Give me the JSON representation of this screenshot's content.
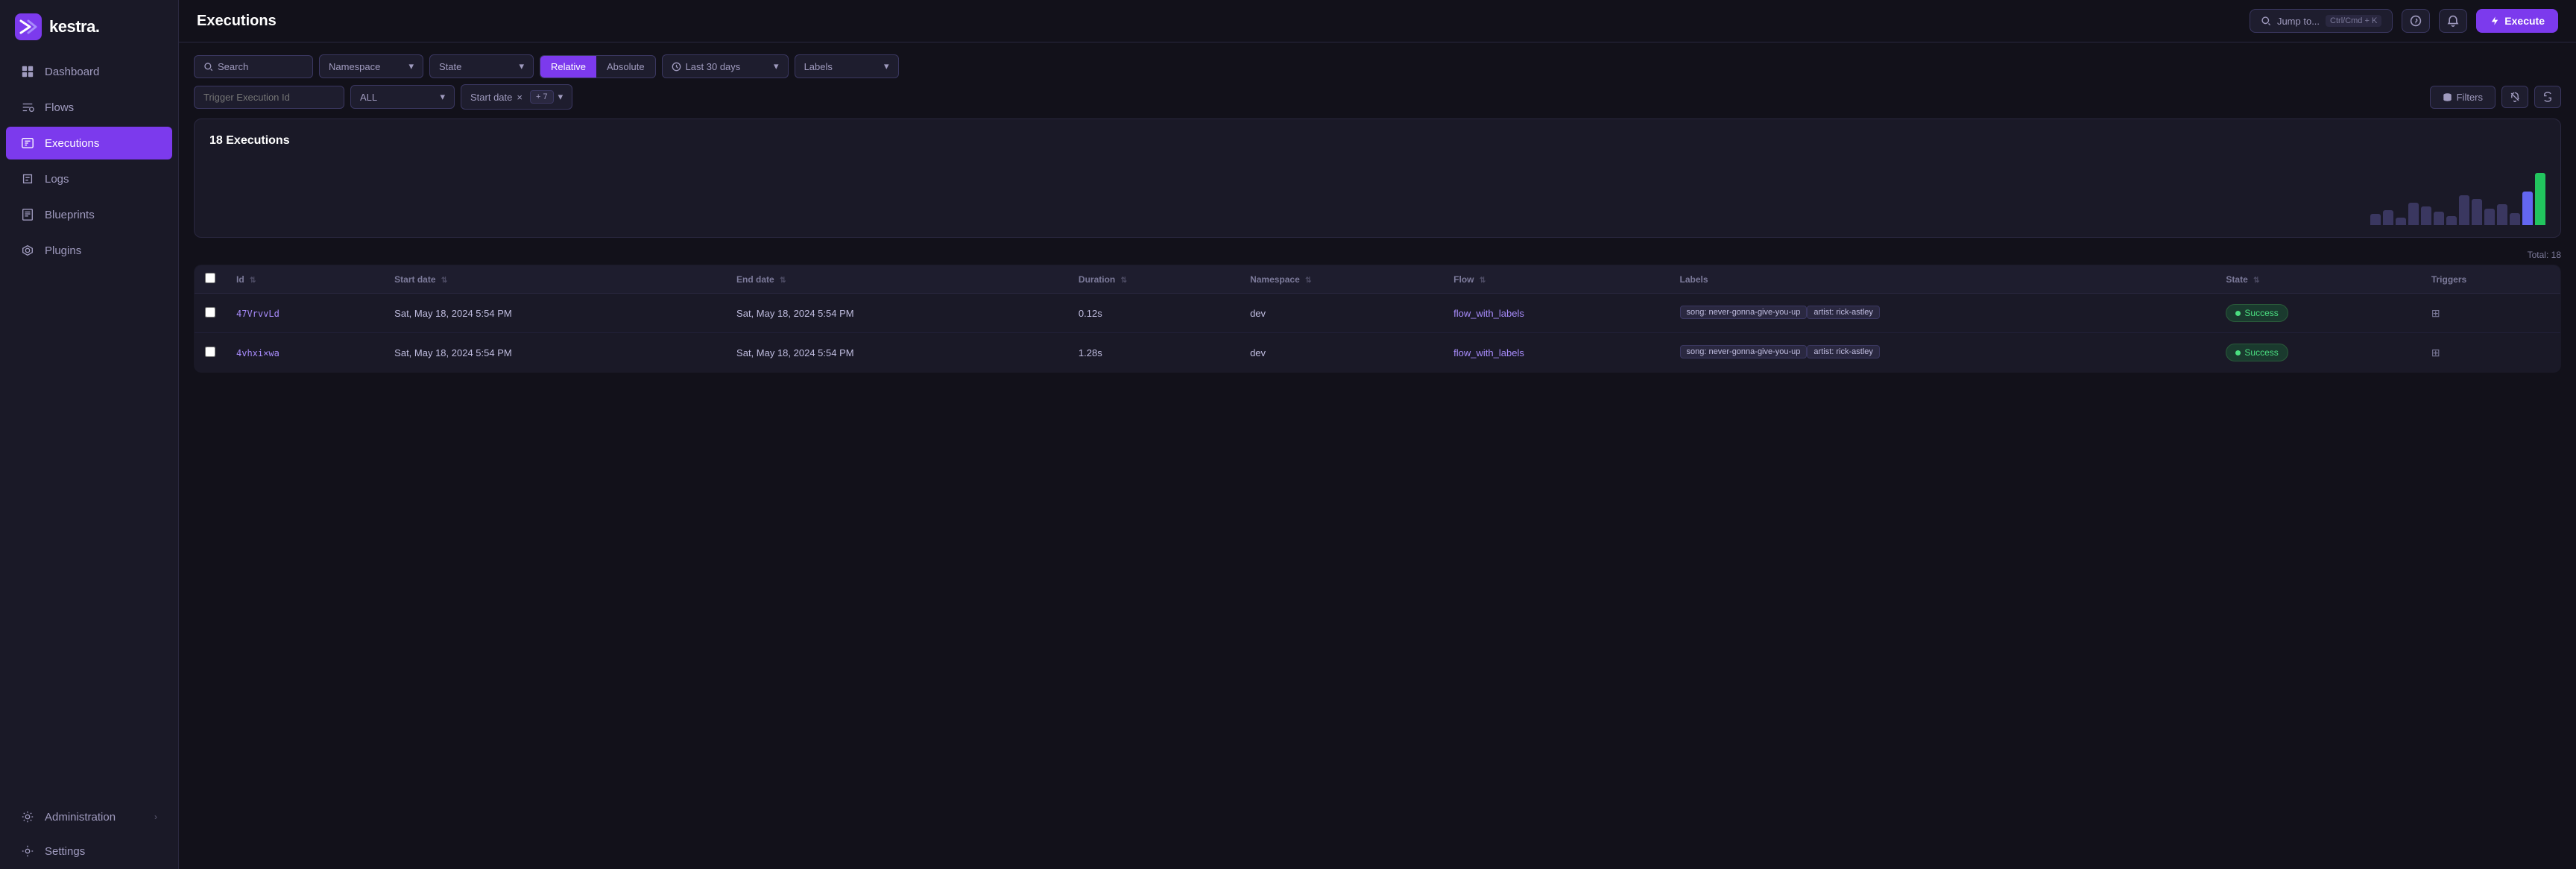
{
  "sidebar": {
    "logo_text": "kestra.",
    "items": [
      {
        "id": "dashboard",
        "label": "Dashboard",
        "icon": "dashboard"
      },
      {
        "id": "flows",
        "label": "Flows",
        "icon": "flows"
      },
      {
        "id": "executions",
        "label": "Executions",
        "icon": "executions",
        "active": true
      },
      {
        "id": "logs",
        "label": "Logs",
        "icon": "logs"
      },
      {
        "id": "blueprints",
        "label": "Blueprints",
        "icon": "blueprints"
      },
      {
        "id": "plugins",
        "label": "Plugins",
        "icon": "plugins"
      },
      {
        "id": "administration",
        "label": "Administration",
        "icon": "administration",
        "has_arrow": true
      },
      {
        "id": "settings",
        "label": "Settings",
        "icon": "settings"
      }
    ]
  },
  "topbar": {
    "page_title": "Executions",
    "jump_to_label": "Jump to...",
    "shortcut": "Ctrl/Cmd + K",
    "execute_label": "Execute"
  },
  "filters": {
    "search_placeholder": "Search",
    "namespace_label": "Namespace",
    "state_label": "State",
    "relative_label": "Relative",
    "absolute_label": "Absolute",
    "date_range_label": "Last 30 days",
    "labels_label": "Labels",
    "trigger_execution_id_placeholder": "Trigger Execution Id",
    "all_label": "ALL",
    "start_date_label": "Start date",
    "plus_filters": "+ 7",
    "filters_label": "Filters"
  },
  "executions_card": {
    "count_label": "18 Executions",
    "chart_bars": [
      {
        "height": 15,
        "color": "#3a3760"
      },
      {
        "height": 20,
        "color": "#3a3760"
      },
      {
        "height": 10,
        "color": "#3a3760"
      },
      {
        "height": 30,
        "color": "#3a3760"
      },
      {
        "height": 25,
        "color": "#3a3760"
      },
      {
        "height": 18,
        "color": "#3a3760"
      },
      {
        "height": 12,
        "color": "#3a3760"
      },
      {
        "height": 40,
        "color": "#3a3760"
      },
      {
        "height": 35,
        "color": "#3a3760"
      },
      {
        "height": 22,
        "color": "#3a3760"
      },
      {
        "height": 28,
        "color": "#3a3760"
      },
      {
        "height": 16,
        "color": "#3a3760"
      },
      {
        "height": 45,
        "color": "#6366f1"
      },
      {
        "height": 70,
        "color": "#22c55e"
      }
    ]
  },
  "table": {
    "total_label": "Total: 18",
    "columns": [
      "",
      "Id",
      "Start date",
      "End date",
      "Duration",
      "Namespace",
      "Flow",
      "Labels",
      "State",
      "Triggers"
    ],
    "rows": [
      {
        "id": "47VrvvLd",
        "start_date": "Sat, May 18, 2024 5:54 PM",
        "end_date": "Sat, May 18, 2024 5:54 PM",
        "duration": "0.12s",
        "namespace": "dev",
        "flow": "flow_with_labels",
        "labels": [
          "song: never-gonna-give-you-up",
          "artist: rick-astley"
        ],
        "state": "Success",
        "has_trigger": true
      },
      {
        "id": "4vhxi×wa",
        "start_date": "Sat, May 18, 2024 5:54 PM",
        "end_date": "Sat, May 18, 2024 5:54 PM",
        "duration": "1.28s",
        "namespace": "dev",
        "flow": "flow_with_labels",
        "labels": [
          "song: never-gonna-give-you-up",
          "artist: rick-astley"
        ],
        "state": "Success",
        "has_trigger": true
      }
    ]
  }
}
